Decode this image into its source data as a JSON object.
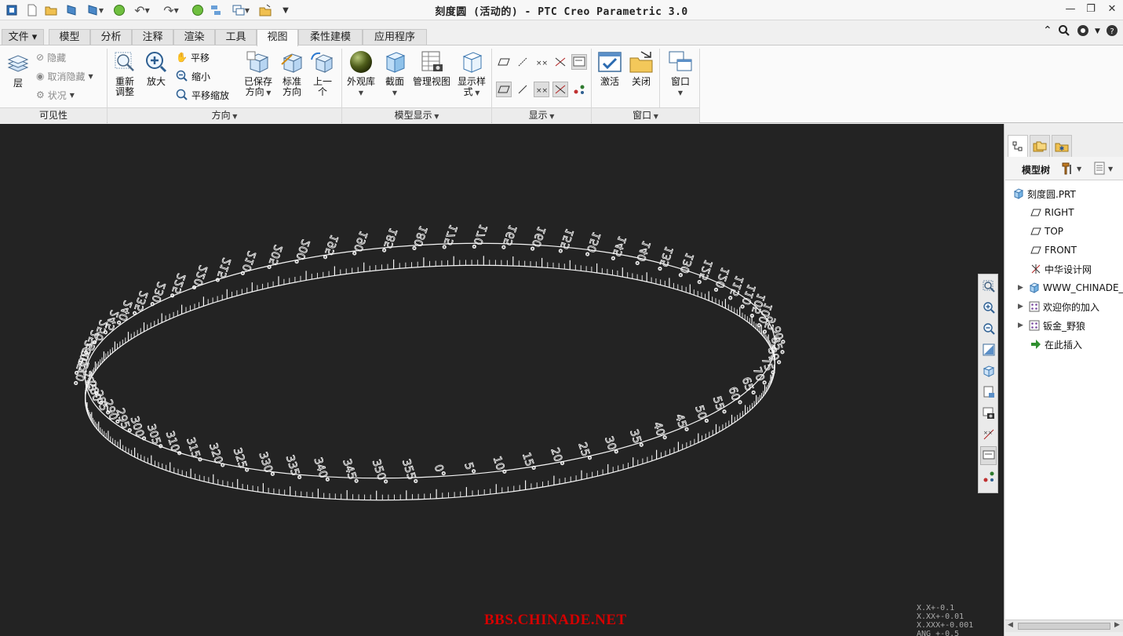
{
  "window": {
    "title": "刻度圆 (活动的) - PTC Creo Parametric 3.0",
    "controls": [
      "—",
      "❐",
      "✕"
    ]
  },
  "tabs": [
    {
      "label": "文件 ▾",
      "active": false
    },
    {
      "label": "模型",
      "active": false
    },
    {
      "label": "分析",
      "active": false
    },
    {
      "label": "注释",
      "active": false
    },
    {
      "label": "渲染",
      "active": false
    },
    {
      "label": "工具",
      "active": false
    },
    {
      "label": "视图",
      "active": true
    },
    {
      "label": "柔性建模",
      "active": false
    },
    {
      "label": "应用程序",
      "active": false
    }
  ],
  "ribbon": {
    "visibility": {
      "label": "可见性",
      "layer": "层",
      "hide": "隐藏",
      "unhide": "取消隐藏",
      "status": "状况"
    },
    "orientation": {
      "label": "方向",
      "refit": [
        "重新",
        "调整"
      ],
      "zoom_in": "放大",
      "pan": "平移",
      "zoom_out": "缩小",
      "pan_zoom": "平移缩放",
      "saved": [
        "已保存",
        "方向"
      ],
      "standard": [
        "标准",
        "方向"
      ],
      "previous": [
        "上一",
        "个"
      ]
    },
    "model_display": {
      "label": "模型显示",
      "appearance": "外观库",
      "section": "截面",
      "view_manager": "管理视图",
      "display_style": [
        "显示样",
        "式"
      ]
    },
    "show": {
      "label": "显示"
    },
    "window": {
      "label": "窗口",
      "activate": "激活",
      "close": "关闭",
      "windows": "窗口"
    }
  },
  "dial": {
    "labels": [
      "0°",
      "5°",
      "10°",
      "15°",
      "20°",
      "25°",
      "30°",
      "35°",
      "40°",
      "45°",
      "50°",
      "55°",
      "60°",
      "65°",
      "70°",
      "75°",
      "80°",
      "85°",
      "90°",
      "95°",
      "100°",
      "105°",
      "110°",
      "115°",
      "120°",
      "125°",
      "130°",
      "135°",
      "140°",
      "145°",
      "150°",
      "155°",
      "160°",
      "165°",
      "170°",
      "175°",
      "180°",
      "185°",
      "190°",
      "195°",
      "200°",
      "205°",
      "210°",
      "215°",
      "220°",
      "225°",
      "230°",
      "235°",
      "240°",
      "245°",
      "250°",
      "255°",
      "260°",
      "265°",
      "270°",
      "275°",
      "280°",
      "285°",
      "290°",
      "295°",
      "300°",
      "305°",
      "310°",
      "315°",
      "320°",
      "325°",
      "330°",
      "335°",
      "340°",
      "345°",
      "350°",
      "355°"
    ],
    "ticks_per_label": 5
  },
  "viewport": {
    "watermark": "BBS.CHINADE.NET",
    "tolerances": [
      "X.X+-0.1",
      "X.XX+-0.01",
      "X.XXX+-0.001",
      "ANG +-0.5"
    ]
  },
  "panel": {
    "toolbar_title": "模型树",
    "tree": [
      {
        "label": "刻度圆.PRT",
        "icon": "part-icon",
        "level": 0,
        "expandable": false
      },
      {
        "label": "RIGHT",
        "icon": "datum-plane-icon",
        "level": 1,
        "expandable": false
      },
      {
        "label": "TOP",
        "icon": "datum-plane-icon",
        "level": 1,
        "expandable": false
      },
      {
        "label": "FRONT",
        "icon": "datum-plane-icon",
        "level": 1,
        "expandable": false
      },
      {
        "label": "中华设计网",
        "icon": "csys-icon",
        "level": 1,
        "expandable": false
      },
      {
        "label": "WWW_CHINADE_",
        "icon": "extrude-icon",
        "level": 1,
        "expandable": true
      },
      {
        "label": "欢迎你的加入",
        "icon": "pattern-icon",
        "level": 1,
        "expandable": true
      },
      {
        "label": "钣金_野狼",
        "icon": "pattern-icon",
        "level": 1,
        "expandable": true
      },
      {
        "label": "在此插入",
        "icon": "insert-arrow-icon",
        "level": 1,
        "expandable": false
      }
    ]
  },
  "colors": {
    "viewport_bg": "#232323",
    "dial": "#f4f4f4",
    "watermark": "#d40000"
  }
}
